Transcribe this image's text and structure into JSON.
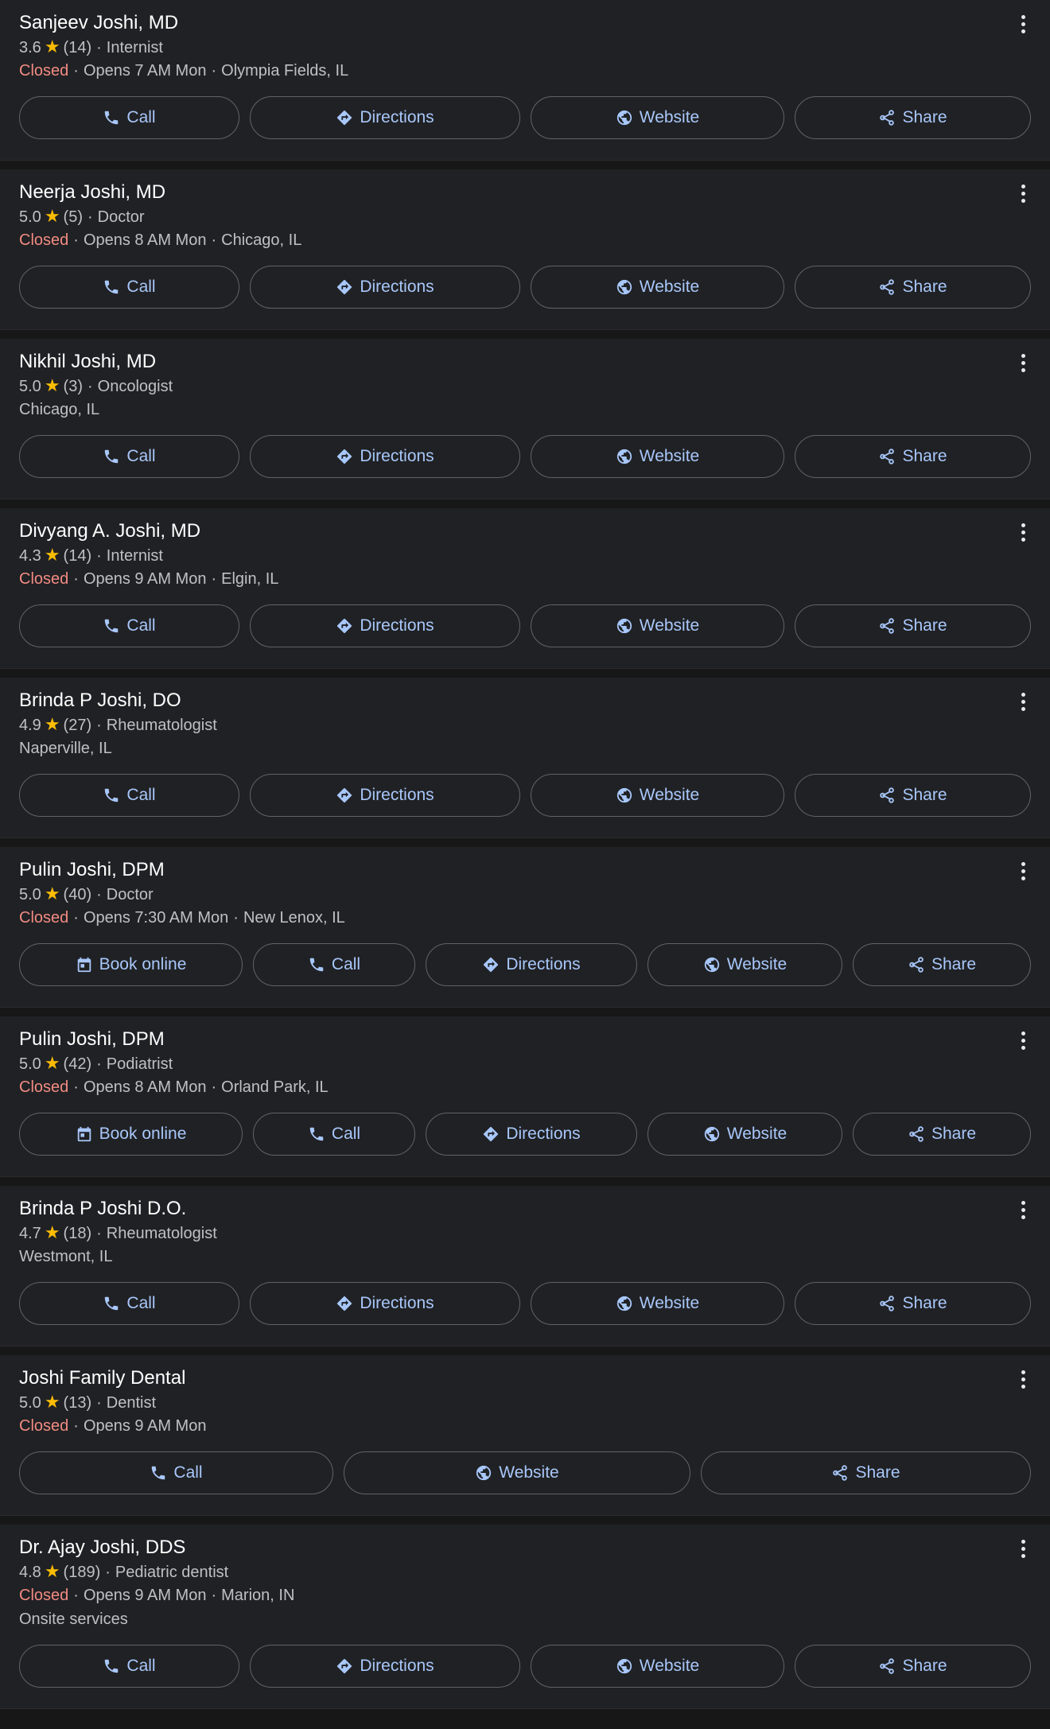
{
  "colors": {
    "background": "#171717",
    "card": "#202124",
    "accent": "#a8c7fa",
    "star": "#fbbc04",
    "closed": "#f28b82",
    "secondary_text": "#bdc1c6"
  },
  "star_glyph": "★",
  "separator": "·",
  "listings": [
    {
      "name": "Sanjeev Joshi, MD",
      "rating": "3.6",
      "reviews": "(14)",
      "category": "Internist",
      "status": "Closed",
      "hours": "Opens 7 AM Mon",
      "location": "Olympia Fields, IL",
      "extra": "",
      "actions": [
        {
          "label": "Call",
          "icon": "phone-icon"
        },
        {
          "label": "Directions",
          "icon": "directions-icon"
        },
        {
          "label": "Website",
          "icon": "globe-icon"
        },
        {
          "label": "Share",
          "icon": "share-icon"
        }
      ]
    },
    {
      "name": "Neerja Joshi, MD",
      "rating": "5.0",
      "reviews": "(5)",
      "category": "Doctor",
      "status": "Closed",
      "hours": "Opens 8 AM Mon",
      "location": "Chicago, IL",
      "extra": "",
      "actions": [
        {
          "label": "Call",
          "icon": "phone-icon"
        },
        {
          "label": "Directions",
          "icon": "directions-icon"
        },
        {
          "label": "Website",
          "icon": "globe-icon"
        },
        {
          "label": "Share",
          "icon": "share-icon"
        }
      ]
    },
    {
      "name": "Nikhil Joshi, MD",
      "rating": "5.0",
      "reviews": "(3)",
      "category": "Oncologist",
      "status": "",
      "hours": "",
      "location": "Chicago, IL",
      "extra": "",
      "actions": [
        {
          "label": "Call",
          "icon": "phone-icon"
        },
        {
          "label": "Directions",
          "icon": "directions-icon"
        },
        {
          "label": "Website",
          "icon": "globe-icon"
        },
        {
          "label": "Share",
          "icon": "share-icon"
        }
      ]
    },
    {
      "name": "Divyang A. Joshi, MD",
      "rating": "4.3",
      "reviews": "(14)",
      "category": "Internist",
      "status": "Closed",
      "hours": "Opens 9 AM Mon",
      "location": "Elgin, IL",
      "extra": "",
      "actions": [
        {
          "label": "Call",
          "icon": "phone-icon"
        },
        {
          "label": "Directions",
          "icon": "directions-icon"
        },
        {
          "label": "Website",
          "icon": "globe-icon"
        },
        {
          "label": "Share",
          "icon": "share-icon"
        }
      ]
    },
    {
      "name": "Brinda P Joshi, DO",
      "rating": "4.9",
      "reviews": "(27)",
      "category": "Rheumatologist",
      "status": "",
      "hours": "",
      "location": "Naperville, IL",
      "extra": "",
      "actions": [
        {
          "label": "Call",
          "icon": "phone-icon"
        },
        {
          "label": "Directions",
          "icon": "directions-icon"
        },
        {
          "label": "Website",
          "icon": "globe-icon"
        },
        {
          "label": "Share",
          "icon": "share-icon"
        }
      ]
    },
    {
      "name": "Pulin Joshi, DPM",
      "rating": "5.0",
      "reviews": "(40)",
      "category": "Doctor",
      "status": "Closed",
      "hours": "Opens 7:30 AM Mon",
      "location": "New Lenox, IL",
      "extra": "",
      "actions": [
        {
          "label": "Book online",
          "icon": "calendar-icon"
        },
        {
          "label": "Call",
          "icon": "phone-icon"
        },
        {
          "label": "Directions",
          "icon": "directions-icon"
        },
        {
          "label": "Website",
          "icon": "globe-icon"
        },
        {
          "label": "Share",
          "icon": "share-icon"
        }
      ]
    },
    {
      "name": "Pulin Joshi, DPM",
      "rating": "5.0",
      "reviews": "(42)",
      "category": "Podiatrist",
      "status": "Closed",
      "hours": "Opens 8 AM Mon",
      "location": "Orland Park, IL",
      "extra": "",
      "actions": [
        {
          "label": "Book online",
          "icon": "calendar-icon"
        },
        {
          "label": "Call",
          "icon": "phone-icon"
        },
        {
          "label": "Directions",
          "icon": "directions-icon"
        },
        {
          "label": "Website",
          "icon": "globe-icon"
        },
        {
          "label": "Share",
          "icon": "share-icon"
        }
      ]
    },
    {
      "name": "Brinda P Joshi D.O.",
      "rating": "4.7",
      "reviews": "(18)",
      "category": "Rheumatologist",
      "status": "",
      "hours": "",
      "location": "Westmont, IL",
      "extra": "",
      "actions": [
        {
          "label": "Call",
          "icon": "phone-icon"
        },
        {
          "label": "Directions",
          "icon": "directions-icon"
        },
        {
          "label": "Website",
          "icon": "globe-icon"
        },
        {
          "label": "Share",
          "icon": "share-icon"
        }
      ]
    },
    {
      "name": "Joshi Family Dental",
      "rating": "5.0",
      "reviews": "(13)",
      "category": "Dentist",
      "status": "Closed",
      "hours": "Opens 9 AM Mon",
      "location": "",
      "extra": "",
      "actions": [
        {
          "label": "Call",
          "icon": "phone-icon"
        },
        {
          "label": "Website",
          "icon": "globe-icon"
        },
        {
          "label": "Share",
          "icon": "share-icon"
        }
      ]
    },
    {
      "name": "Dr. Ajay Joshi, DDS",
      "rating": "4.8",
      "reviews": "(189)",
      "category": "Pediatric dentist",
      "status": "Closed",
      "hours": "Opens 9 AM Mon",
      "location": "Marion, IN",
      "extra": "Onsite services",
      "actions": [
        {
          "label": "Call",
          "icon": "phone-icon"
        },
        {
          "label": "Directions",
          "icon": "directions-icon"
        },
        {
          "label": "Website",
          "icon": "globe-icon"
        },
        {
          "label": "Share",
          "icon": "share-icon"
        }
      ]
    }
  ]
}
